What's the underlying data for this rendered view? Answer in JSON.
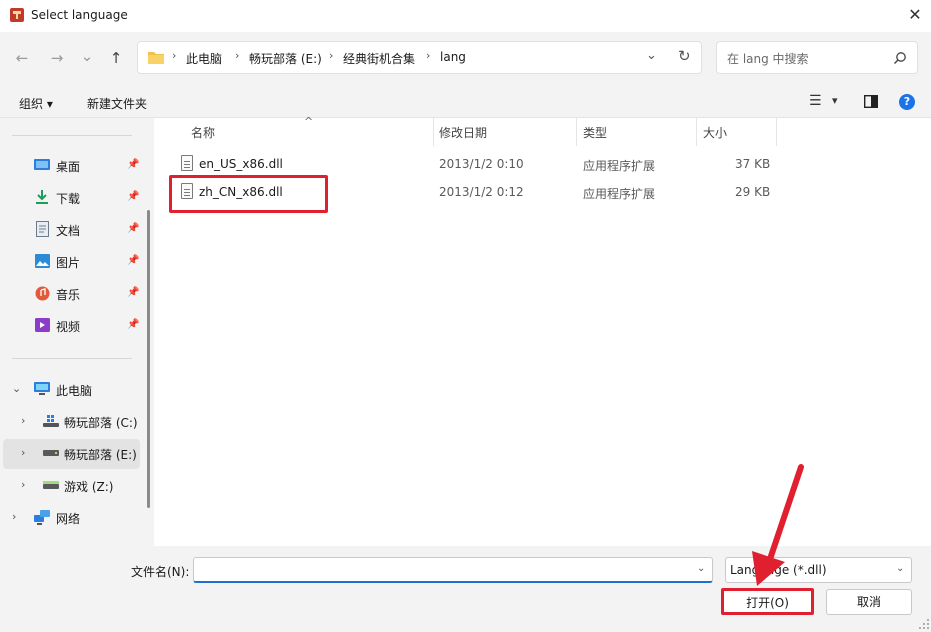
{
  "window": {
    "title": "Select language",
    "close": "✕"
  },
  "nav": {
    "back": "←",
    "forward": "→",
    "recent": "⌄",
    "up": "↑",
    "breadcrumb": [
      "此电脑",
      "畅玩部落 (E:)",
      "经典街机合集",
      "lang"
    ],
    "dropdown": "⌄",
    "refresh": "↻"
  },
  "search": {
    "placeholder": "在 lang 中搜索",
    "icon": "search-icon"
  },
  "toolbar": {
    "organize": "组织 ▾",
    "new_folder": "新建文件夹",
    "view_icon": "☰",
    "view_dd": "▾",
    "preview_icon": "▮",
    "help": "?"
  },
  "sidebar": {
    "quick_access": [
      {
        "label": "桌面",
        "icon": "desktop-icon",
        "color": "#2b7de0"
      },
      {
        "label": "下载",
        "icon": "download-icon",
        "color": "#1d9c5a"
      },
      {
        "label": "文档",
        "icon": "document-icon",
        "color": "#6b7b8c"
      },
      {
        "label": "图片",
        "icon": "picture-icon",
        "color": "#2b8bd6"
      },
      {
        "label": "音乐",
        "icon": "music-icon",
        "color": "#e05a3c"
      },
      {
        "label": "视频",
        "icon": "video-icon",
        "color": "#8b3cc9"
      }
    ],
    "this_pc": "此电脑",
    "drives": [
      {
        "label": "畅玩部落 (C:)",
        "icon": "windows-drive-icon"
      },
      {
        "label": "畅玩部落 (E:)",
        "icon": "drive-icon"
      },
      {
        "label": "游戏 (Z:)",
        "icon": "drive-icon"
      }
    ],
    "network": "网络",
    "pin": "📌"
  },
  "columns": {
    "name": "名称",
    "modified": "修改日期",
    "type": "类型",
    "size": "大小",
    "sort_arrow": "^"
  },
  "files": [
    {
      "name": "en_US_x86.dll",
      "modified": "2013/1/2 0:10",
      "type": "应用程序扩展",
      "size": "37 KB"
    },
    {
      "name": "zh_CN_x86.dll",
      "modified": "2013/1/2 0:12",
      "type": "应用程序扩展",
      "size": "29 KB"
    }
  ],
  "footer": {
    "filename_label": "文件名(N):",
    "filename_value": "",
    "filetype": "Language (*.dll)",
    "open": "打开(O)",
    "cancel": "取消"
  },
  "colors": {
    "highlight": "#e0202f",
    "accent": "#1d6fd1",
    "help_blue": "#1a73e8"
  }
}
